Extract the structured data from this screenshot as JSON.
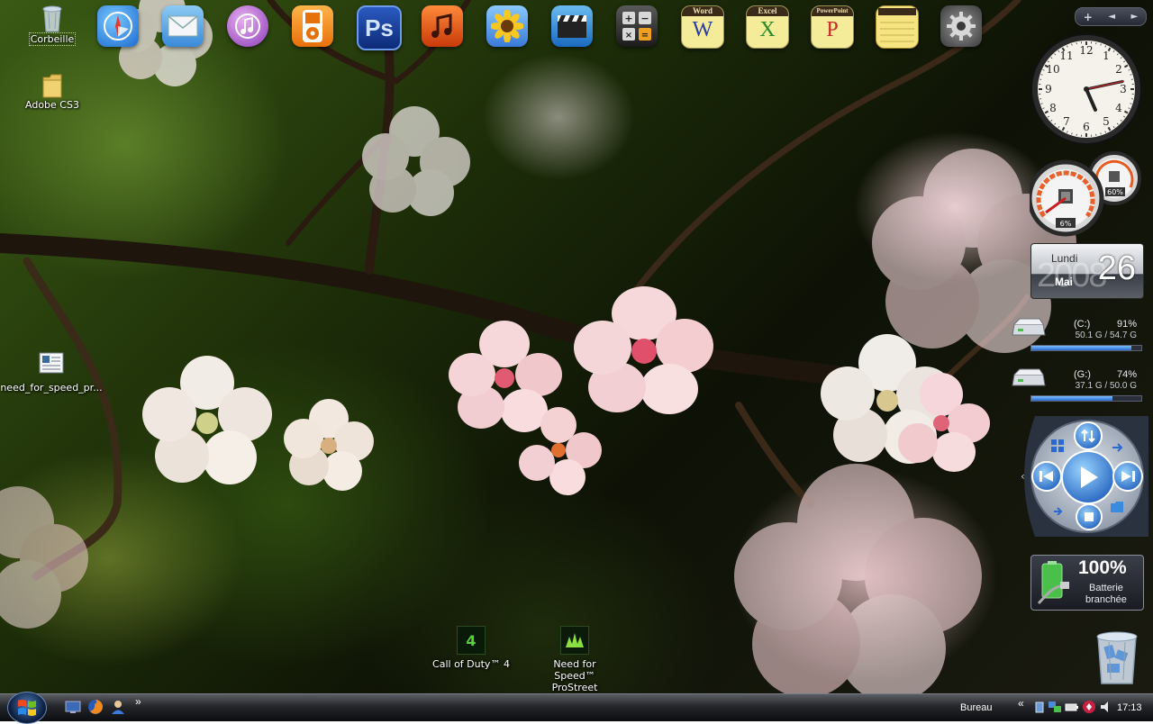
{
  "desktop": {
    "icons": [
      {
        "label": "Corbeille",
        "icon": "recycle-bin-icon"
      },
      {
        "label": "Adobe CS3",
        "icon": "folder-icon"
      },
      {
        "label": "need_for_speed_pr...",
        "icon": "document-icon"
      },
      {
        "label": "Call of Duty™ 4",
        "icon": "cod4-icon"
      },
      {
        "label": "Need for Speed™ ProStreet",
        "icon": "nfs-icon"
      }
    ]
  },
  "dock": {
    "items": [
      {
        "name": "safari",
        "icon": "compass-icon",
        "color": "#2a7fd8"
      },
      {
        "name": "mail",
        "icon": "mail-icon",
        "color": "#5aa7e8"
      },
      {
        "name": "itunes",
        "icon": "music-note-icon",
        "color": "#a05ad0"
      },
      {
        "name": "ipod",
        "icon": "ipod-icon",
        "color": "#f28a1a"
      },
      {
        "name": "photoshop",
        "icon": "photoshop-icon",
        "label": "Ps",
        "color": "#1f4fa8"
      },
      {
        "name": "garageband",
        "icon": "music-icon",
        "color": "#e85a14"
      },
      {
        "name": "iphoto",
        "icon": "sunflower-icon",
        "color": "#4a9ad8"
      },
      {
        "name": "imovie",
        "icon": "clapperboard-icon",
        "color": "#3a8ad0"
      },
      {
        "name": "calculator",
        "icon": "calculator-icon",
        "color": "#3a3a3a"
      },
      {
        "name": "word",
        "icon": "word-icon",
        "label": "Word",
        "letter": "W",
        "color": "#f5ec9a"
      },
      {
        "name": "excel",
        "icon": "excel-icon",
        "label": "Excel",
        "letter": "X",
        "color": "#f5ec9a"
      },
      {
        "name": "powerpoint",
        "icon": "powerpoint-icon",
        "label": "PowerPoint",
        "letter": "P",
        "color": "#f5ec9a"
      },
      {
        "name": "notes",
        "icon": "notepad-icon",
        "color": "#f5e480"
      },
      {
        "name": "settings",
        "icon": "gear-icon",
        "color": "#7a7a7a"
      }
    ]
  },
  "sidebar": {
    "controls": [
      "+",
      "◄",
      "►"
    ],
    "clock": {
      "hour": 5,
      "minute": 13,
      "second": 13
    },
    "cpu_meter": {
      "cpu_percent_label": "6%",
      "cpu_percent": 6,
      "ram_percent_label": "60%",
      "ram_percent": 60
    },
    "calendar": {
      "day_name": "Lundi",
      "day_number": "26",
      "month": "Mai",
      "year_watermark": "2008"
    },
    "drives": [
      {
        "letter": "(C:)",
        "percent_label": "91%",
        "percent": 91,
        "usage": "50.1 G / 54.7 G"
      },
      {
        "letter": "(G:)",
        "percent_label": "74%",
        "percent": 74,
        "usage": "37.1 G / 50.0 G"
      }
    ],
    "battery": {
      "percent": "100%",
      "status_line1": "Batterie",
      "status_line2": "branchée"
    }
  },
  "taskbar": {
    "start_icon": "windows-logo-icon",
    "quick_launch": [
      "show-desktop-icon",
      "firefox-icon",
      "user-icon"
    ],
    "overflow": "»",
    "toolbar_label": "Bureau",
    "toolbar_overflow": "«",
    "clock": "17:13"
  },
  "colors": {
    "taskbar": "#1a1b1f",
    "accent": "#2a7fd8"
  }
}
